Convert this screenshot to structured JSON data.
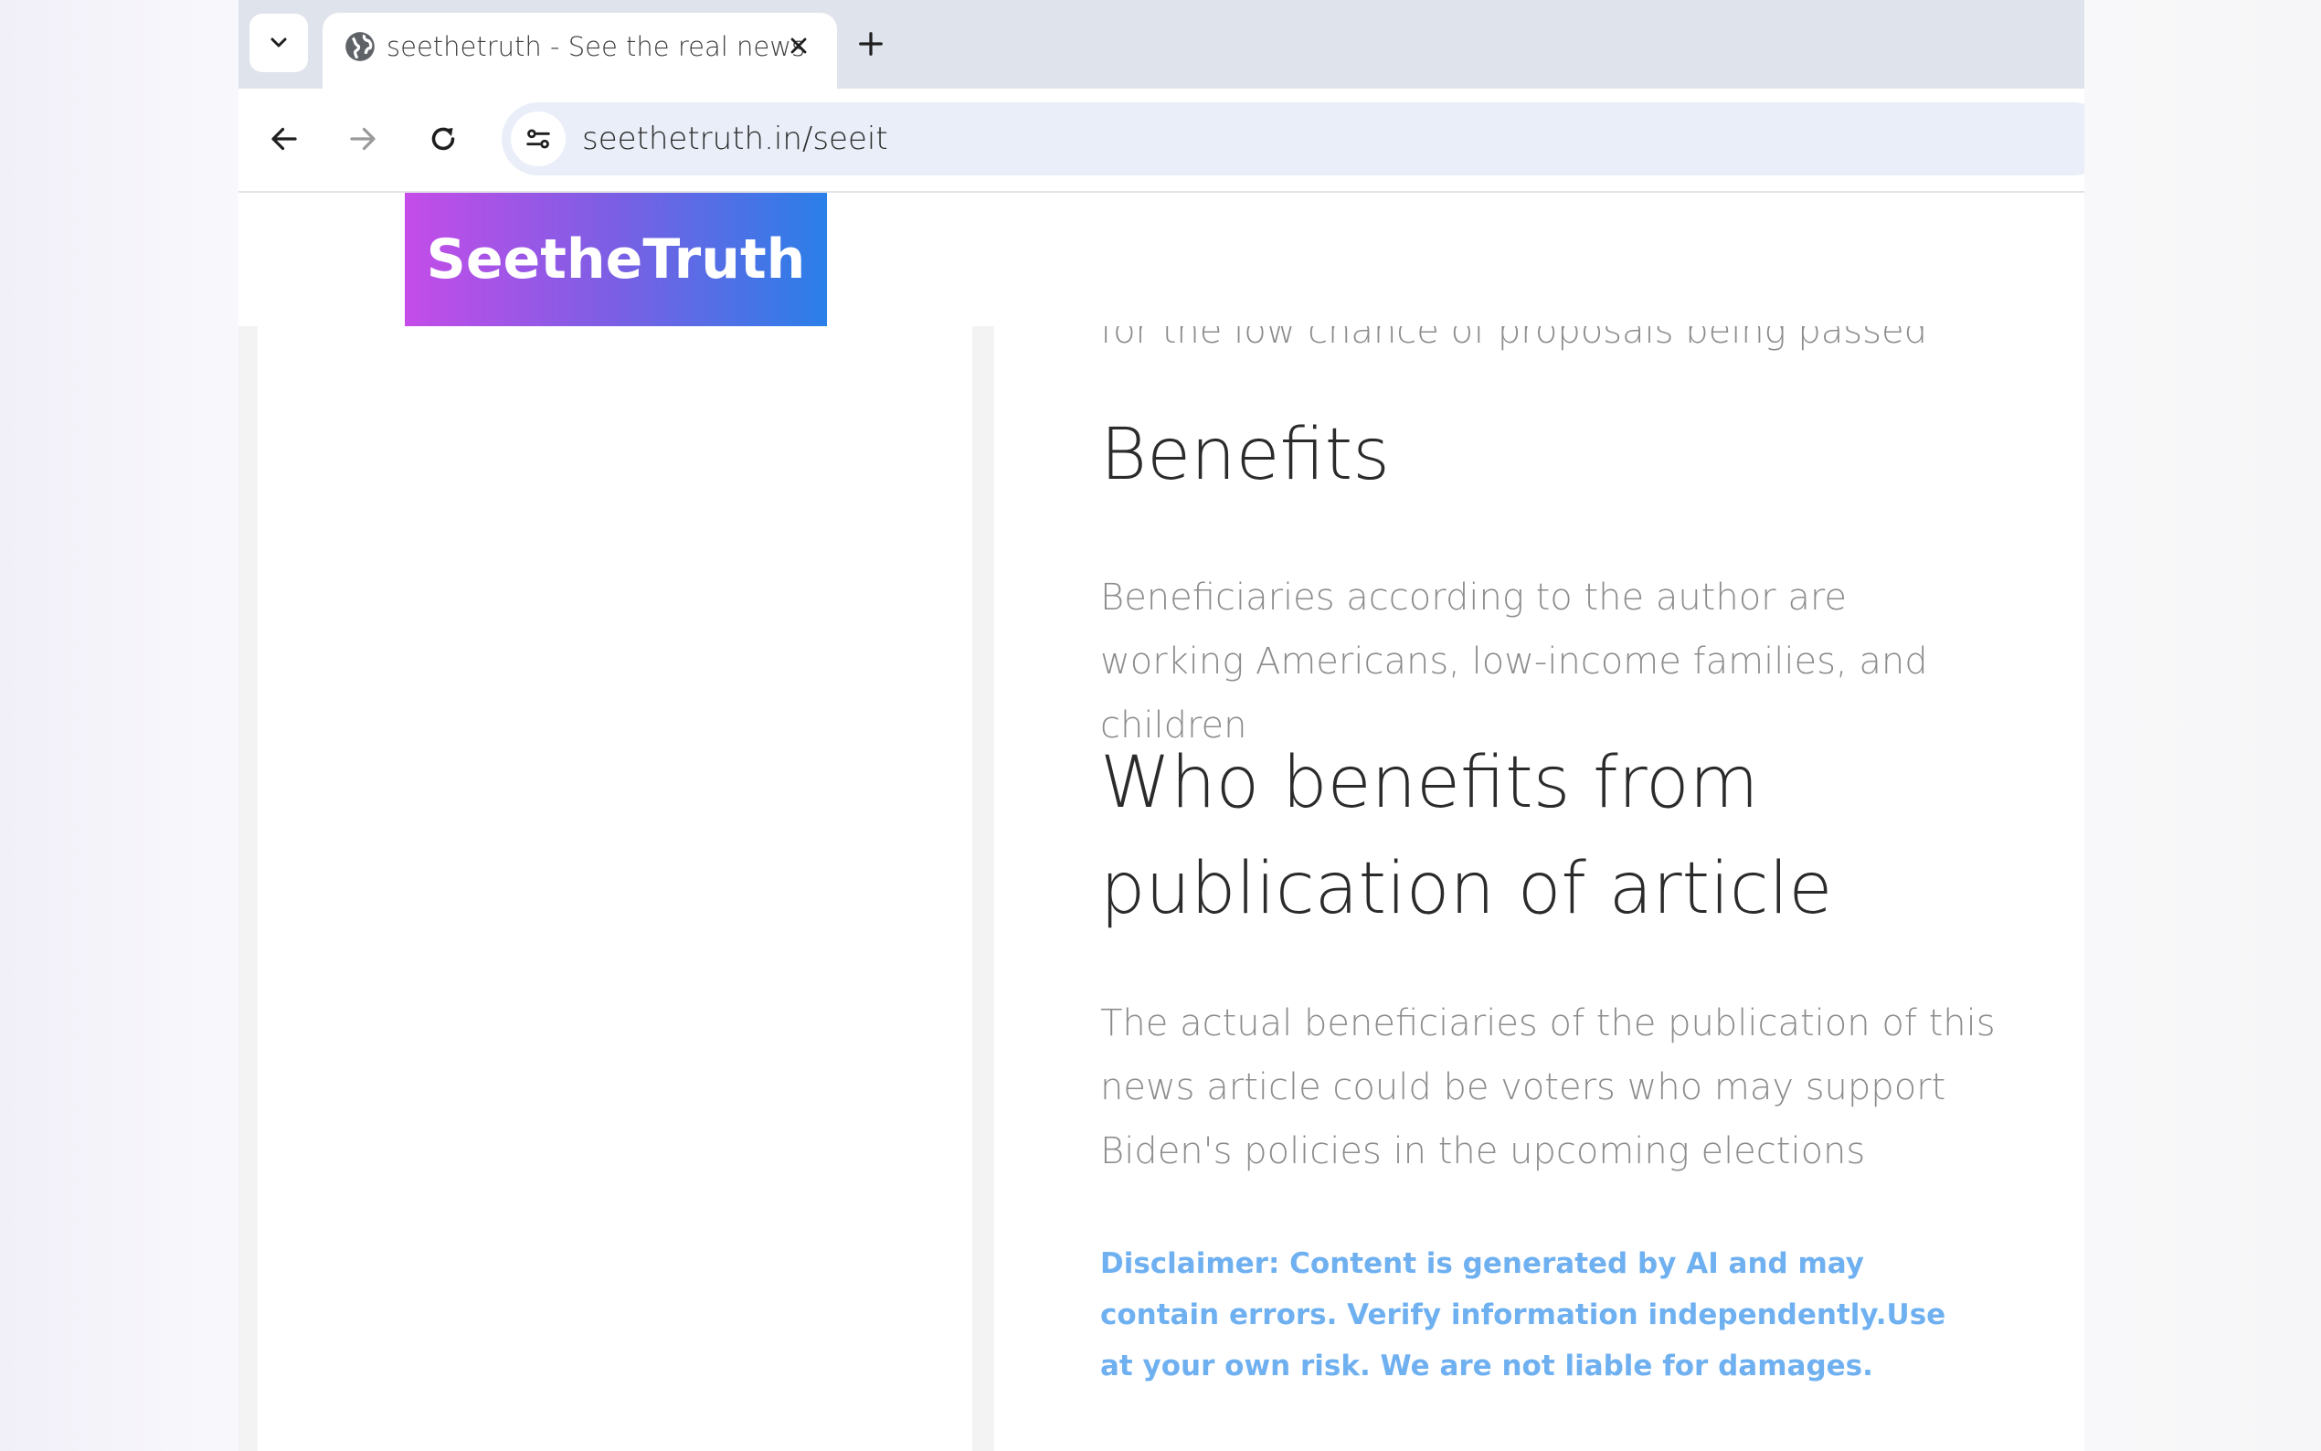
{
  "browser": {
    "tab": {
      "title": "seethetruth - See the real news"
    },
    "address_bar": {
      "url": "seethetruth.in/seeit"
    },
    "icons": {
      "tab_search": "chevron-down-icon",
      "tab_favicon": "globe-icon",
      "tab_close": "close-icon",
      "new_tab": "plus-icon",
      "back": "arrow-left-icon",
      "forward": "arrow-right-icon",
      "reload": "reload-icon",
      "site_info": "tune-icon"
    }
  },
  "site": {
    "logo_text": "SeetheTruth",
    "logo_gradient": [
      "#c54ce8",
      "#2a7fe8"
    ]
  },
  "article": {
    "cut_line": "for the low chance of proposals being passed",
    "benefits_heading": "Benefits",
    "benefits_text": "Beneficiaries according to the author are working Americans, low-income families, and children",
    "who_heading": "Who benefits from publication of article",
    "who_text": "The actual beneficiaries of the publication of this news article could be voters who may support Biden's policies in the upcoming elections",
    "disclaimer": "Disclaimer: Content is generated by AI and may contain errors. Verify information independently.Use at your own risk. We are not liable for damages."
  },
  "colors": {
    "disclaimer": "#6fb0f0",
    "heading": "#2b2b2b",
    "body_text": "#8c8c8c",
    "tabstrip": "#dfe3eb"
  }
}
